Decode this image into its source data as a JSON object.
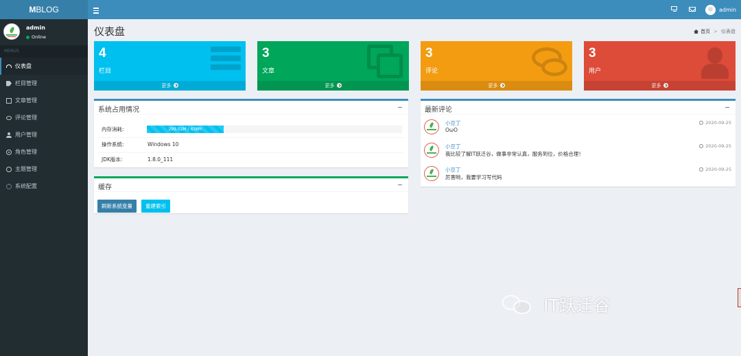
{
  "app": {
    "logo_bold": "M",
    "logo_rest": "BLOG"
  },
  "topbar": {
    "username": "admin",
    "icons": [
      "bars-icon",
      "monitor-icon",
      "envelope-icon",
      "user-avatar"
    ]
  },
  "sidebar": {
    "user": {
      "name": "admin",
      "status": "Online"
    },
    "menus_header": "MENUS",
    "items": [
      {
        "label": "仪表盘",
        "icon": "dashboard-icon",
        "active": true
      },
      {
        "label": "栏目管理",
        "icon": "tag-icon"
      },
      {
        "label": "文章管理",
        "icon": "copy-icon"
      },
      {
        "label": "评论管理",
        "icon": "comments-icon"
      },
      {
        "label": "用户管理",
        "icon": "user-icon"
      },
      {
        "label": "角色管理",
        "icon": "role-icon"
      },
      {
        "label": "主题管理",
        "icon": "circle-icon"
      },
      {
        "label": "系统配置",
        "icon": "gear-icon"
      }
    ]
  },
  "page": {
    "title": "仪表盘",
    "breadcrumb": [
      "首页",
      "仪表盘"
    ]
  },
  "stat_boxes": [
    {
      "count": "4",
      "label": "栏目",
      "more": "更多",
      "color": "#00c0ef",
      "icon": "bars-icon"
    },
    {
      "count": "3",
      "label": "文章",
      "more": "更多",
      "color": "#00a65a",
      "icon": "copy-icon"
    },
    {
      "count": "3",
      "label": "评论",
      "more": "更多",
      "color": "#f39c12",
      "icon": "comments-icon"
    },
    {
      "count": "3",
      "label": "用户",
      "more": "更多",
      "color": "#dd4b39",
      "icon": "user-icon"
    }
  ],
  "system": {
    "title": "系统占用情况",
    "rows": [
      {
        "label": "内存消耗:",
        "value": "299.02M / 438M",
        "progress": 0.3
      },
      {
        "label": "操作系统:",
        "value": "Windows 10"
      },
      {
        "label": "JDK版本:",
        "value": "1.8.0_111"
      }
    ]
  },
  "cache": {
    "title": "缓存",
    "buttons": [
      "刷新系统变量",
      "重建索引"
    ]
  },
  "comments": {
    "title": "最新评论",
    "items": [
      {
        "author": "小豆丁",
        "text": "OωO",
        "time": "2020-09-25"
      },
      {
        "author": "小豆丁",
        "text": "我比较了解IT跃迁谷，做事非常认真，服务到位，价格合理！",
        "time": "2020-09-25"
      },
      {
        "author": "小豆丁",
        "text": "厉害哟，我要学习写代码",
        "time": "2020-09-25"
      }
    ]
  },
  "watermark": {
    "text": "IT跃迁谷"
  }
}
